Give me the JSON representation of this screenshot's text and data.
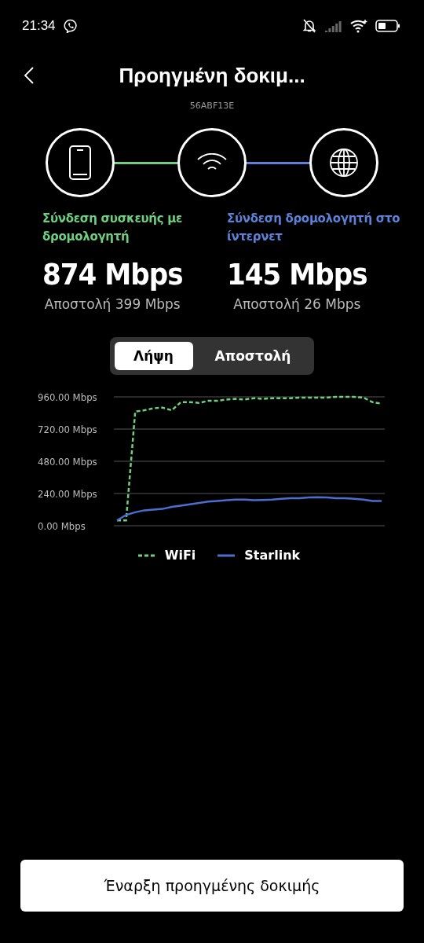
{
  "status_bar": {
    "time": "21:34"
  },
  "header": {
    "title": "Προηγμένη δοκιμ...",
    "subtitle": "56ABF13E"
  },
  "links": [
    {
      "label": "Σύνδεση συσκευής με δρομολογητή",
      "color": "#6fcf7f",
      "speed": "874 Mbps",
      "upload": "Αποστολή 399 Mbps"
    },
    {
      "label": "Σύνδεση δρομολογητή στο ίντερνετ",
      "color": "#5b82d8",
      "speed": "145 Mbps",
      "upload": "Αποστολή 26 Mbps"
    }
  ],
  "tabs": [
    {
      "label": "Λήψη",
      "selected": true
    },
    {
      "label": "Αποστολή",
      "selected": false
    }
  ],
  "chart": {
    "chart_data": {
      "type": "line",
      "ylim": [
        0,
        960
      ],
      "yticks": [
        {
          "value": 0,
          "label": "0.00 Mbps"
        },
        {
          "value": 240,
          "label": "240.00 Mbps"
        },
        {
          "value": 480,
          "label": "480.00 Mbps"
        },
        {
          "value": 720,
          "label": "720.00 Mbps"
        },
        {
          "value": 960,
          "label": "960.00 Mbps"
        }
      ],
      "grid": true,
      "series": [
        {
          "name": "WiFi",
          "color": "#6fcf7f",
          "line_style": "dashed",
          "values": [
            40,
            40,
            850,
            860,
            875,
            880,
            860,
            920,
            920,
            915,
            930,
            930,
            940,
            945,
            940,
            950,
            945,
            950,
            950,
            950,
            955,
            955,
            955,
            955,
            960,
            960,
            960,
            955,
            920,
            910
          ]
        },
        {
          "name": "Starlink",
          "color": "#4a6fd0",
          "line_style": "solid",
          "values": [
            40,
            80,
            100,
            115,
            120,
            125,
            140,
            150,
            160,
            170,
            180,
            185,
            190,
            195,
            195,
            190,
            192,
            195,
            200,
            205,
            205,
            210,
            212,
            210,
            205,
            205,
            200,
            195,
            185,
            185
          ]
        }
      ]
    }
  },
  "start_button": {
    "label": "Έναρξη προηγμένης δοκιμής"
  }
}
